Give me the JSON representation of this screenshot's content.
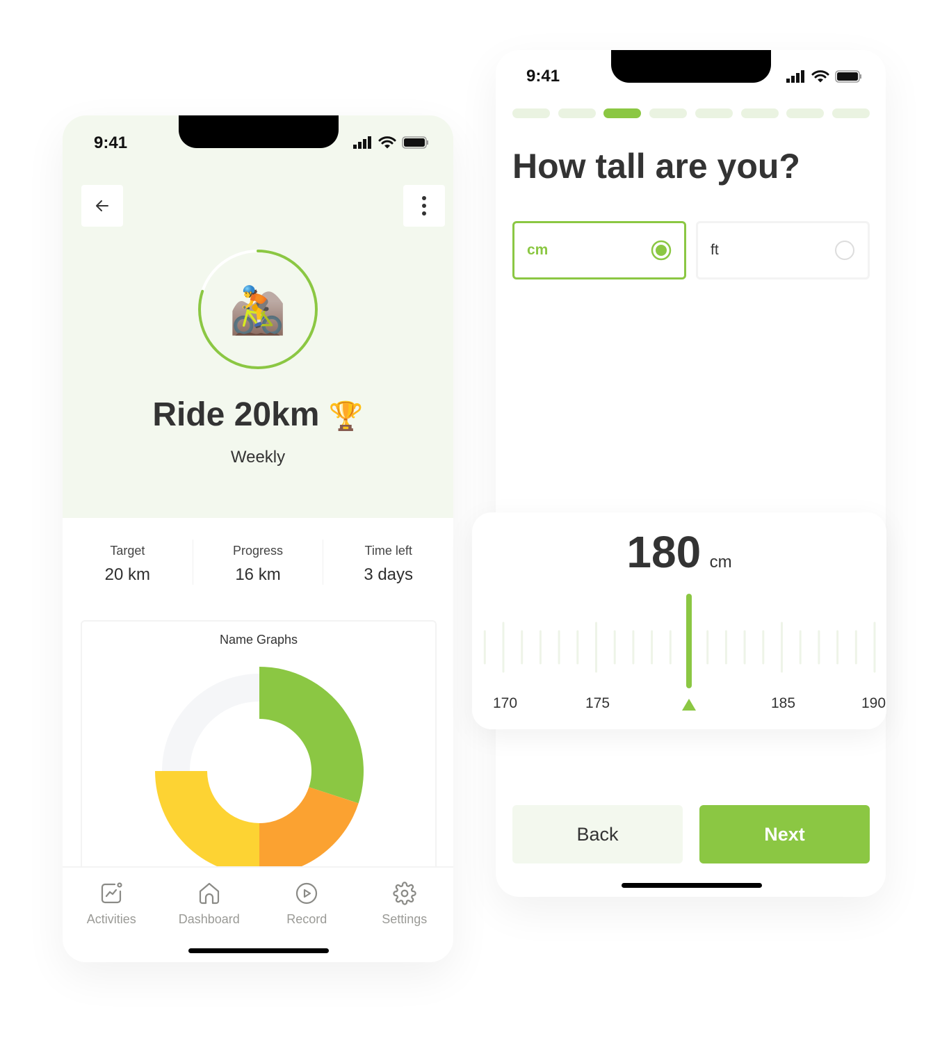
{
  "left_screen": {
    "status": {
      "time": "9:41"
    },
    "back_icon": "arrow-left-icon",
    "more_icon": "more-vertical-icon",
    "challenge_icon": "🚵",
    "challenge_progress_percent": 80,
    "title": "Ride 20km",
    "title_emoji": "🏆",
    "subtitle": "Weekly",
    "stats": [
      {
        "label": "Target",
        "value": "20 km"
      },
      {
        "label": "Progress",
        "value": "16 km"
      },
      {
        "label": "Time left",
        "value": "3 days"
      }
    ],
    "graph": {
      "title": "Name Graphs",
      "slices": [
        {
          "percent": 30,
          "color": "#8bc743"
        },
        {
          "percent": 20,
          "color": "#fba231"
        },
        {
          "percent": 25,
          "color": "#fdd333"
        },
        {
          "percent": 25,
          "color": "#f5f6f8"
        }
      ]
    },
    "nav": [
      {
        "label": "Activities",
        "icon": "activity-chart-icon"
      },
      {
        "label": "Dashboard",
        "icon": "home-icon"
      },
      {
        "label": "Record",
        "icon": "play-circle-icon"
      },
      {
        "label": "Settings",
        "icon": "gear-icon"
      }
    ]
  },
  "right_screen": {
    "status": {
      "time": "9:41"
    },
    "steps_total": 8,
    "step_current": 3,
    "question": "How tall are you?",
    "units": [
      {
        "label": "cm",
        "selected": true
      },
      {
        "label": "ft",
        "selected": false
      }
    ],
    "height": {
      "value": "180",
      "unit": "cm",
      "selected": 180,
      "ticks": [
        "170",
        "175",
        "185",
        "190"
      ]
    },
    "back_label": "Back",
    "next_label": "Next"
  },
  "colors": {
    "accent": "#8bc743",
    "hero_bg": "#f3f8ee",
    "text": "#2f2f2f"
  }
}
